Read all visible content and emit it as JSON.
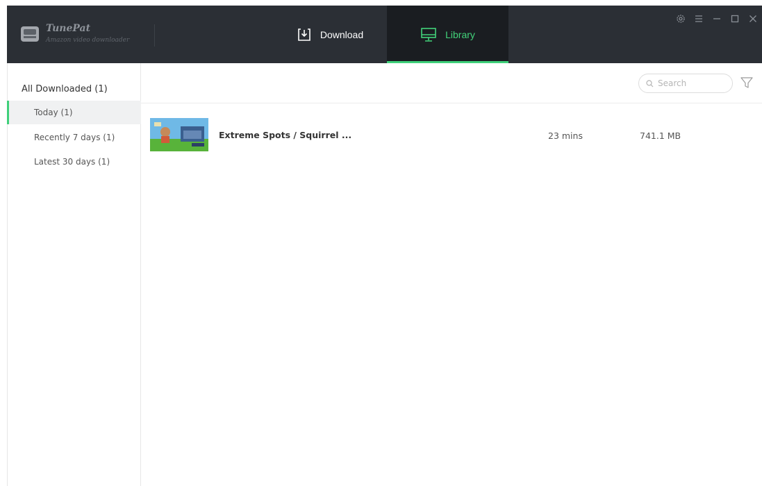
{
  "app": {
    "name": "TunePat",
    "subtitle": "Amazon video downloader"
  },
  "tabs": {
    "download": "Download",
    "library": "Library"
  },
  "sidebar": {
    "header": "All Downloaded (1)",
    "items": [
      {
        "label": "Today (1)",
        "active": true
      },
      {
        "label": "Recently 7 days (1)",
        "active": false
      },
      {
        "label": "Latest 30 days (1)",
        "active": false
      }
    ]
  },
  "search": {
    "placeholder": "Search"
  },
  "rows": [
    {
      "title": "Extreme Spots / Squirrel ...",
      "duration": "23 mins",
      "size": "741.1 MB"
    }
  ],
  "colors": {
    "titlebar": "#2b2f35",
    "accent": "#3fd07a",
    "active_tab_bg": "#1a1d21"
  },
  "icons": {
    "logo": "tunepat-logo",
    "download": "download-icon",
    "library": "monitor-icon",
    "settings": "gear-icon",
    "menu": "menu-icon",
    "minimize": "minimize-icon",
    "maximize": "maximize-icon",
    "close": "close-icon",
    "search": "search-icon",
    "filter": "filter-icon"
  }
}
